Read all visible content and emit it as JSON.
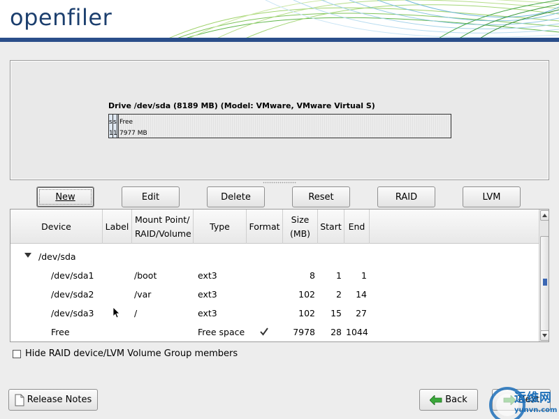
{
  "header": {
    "logo_text": "openfiler"
  },
  "drive": {
    "title": "Drive /dev/sda (8189 MB) (Model: VMware, VMware Virtual S)",
    "segments": [
      {
        "top": "s",
        "bottom": "1"
      },
      {
        "top": "s",
        "bottom": "1"
      },
      {
        "top": "",
        "bottom": ""
      },
      {
        "top": "Free",
        "bottom": "7977 MB"
      }
    ]
  },
  "buttons": {
    "new": "New",
    "edit": "Edit",
    "delete": "Delete",
    "reset": "Reset",
    "raid": "RAID",
    "lvm": "LVM"
  },
  "table": {
    "columns": [
      "Device",
      "Label",
      "Mount Point/\nRAID/Volume",
      "Type",
      "Format",
      "Size\n(MB)",
      "Start",
      "End"
    ],
    "parent": "/dev/sda",
    "rows": [
      {
        "device": "/dev/sda1",
        "label": "",
        "mount": "/boot",
        "type": "ext3",
        "format": true,
        "size": "8",
        "start": "1",
        "end": "1"
      },
      {
        "device": "/dev/sda2",
        "label": "",
        "mount": "/var",
        "type": "ext3",
        "format": true,
        "size": "102",
        "start": "2",
        "end": "14"
      },
      {
        "device": "/dev/sda3",
        "label": "",
        "mount": "/",
        "type": "ext3",
        "format": true,
        "size": "102",
        "start": "15",
        "end": "27"
      },
      {
        "device": "Free",
        "label": "",
        "mount": "",
        "type": "Free space",
        "format": false,
        "size": "7978",
        "start": "28",
        "end": "1044"
      }
    ]
  },
  "hide_members": {
    "label": "Hide RAID device/LVM Volume Group members",
    "checked": false
  },
  "footer": {
    "release_notes": "Release Notes",
    "back": "Back",
    "next": "Next"
  },
  "watermark": {
    "text": "运维网",
    "sub": "yunvn.com"
  }
}
